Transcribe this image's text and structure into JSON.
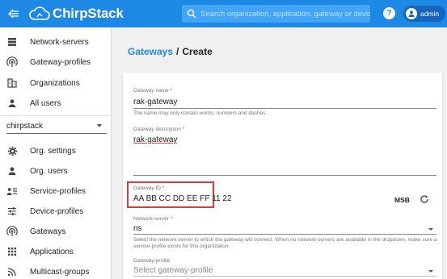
{
  "header": {
    "back_icon": "back-arrow-icon",
    "logo_text": "ChirpStack",
    "search_placeholder": "Search organization, application, gateway or device",
    "help_label": "?",
    "user_name": "admin",
    "colors": {
      "bar": "#1e88e5",
      "search": "#42a5f5",
      "user_chip": "#1565c0"
    }
  },
  "sidebar": {
    "admin_items": [
      {
        "label": "Network-servers",
        "icon": "server-icon"
      },
      {
        "label": "Gateway-profiles",
        "icon": "signal-icon"
      },
      {
        "label": "Organizations",
        "icon": "building-icon"
      },
      {
        "label": "All users",
        "icon": "person-icon"
      }
    ],
    "org_select_value": "chirpstack",
    "org_items": [
      {
        "label": "Org. settings",
        "icon": "gear-icon"
      },
      {
        "label": "Org. users",
        "icon": "person-icon"
      },
      {
        "label": "Service-profiles",
        "icon": "account-list-icon"
      },
      {
        "label": "Device-profiles",
        "icon": "tune-icon"
      },
      {
        "label": "Gateways",
        "icon": "signal-icon"
      },
      {
        "label": "Applications",
        "icon": "grid-icon"
      },
      {
        "label": "Multicast-groups",
        "icon": "rss-icon"
      }
    ]
  },
  "breadcrumb": {
    "link": "Gateways",
    "separator": "/",
    "current": "Create"
  },
  "form": {
    "name_label": "Gateway name *",
    "name_value": "rak-gateway",
    "name_helper": "The name may only contain words, numbers and dashes.",
    "description_label": "Gateway description *",
    "description_value": "rak-gateway",
    "gateway_id_label": "Gateway ID *",
    "gateway_id_value": "AA BB CC DD EE FF 11 22",
    "byte_order": "MSB",
    "refresh_icon": "refresh-icon",
    "network_server_label": "Network-server *",
    "network_server_value": "ns",
    "network_server_helper": "Select the network-server to which the gateway will connect. When no network-servers are available in the dropdown, make sure a service-profile exists for this organization.",
    "gateway_profile_label": "Gateway-profile",
    "gateway_profile_placeholder": "Select gateway-profile",
    "highlight_color": "#e53935"
  }
}
